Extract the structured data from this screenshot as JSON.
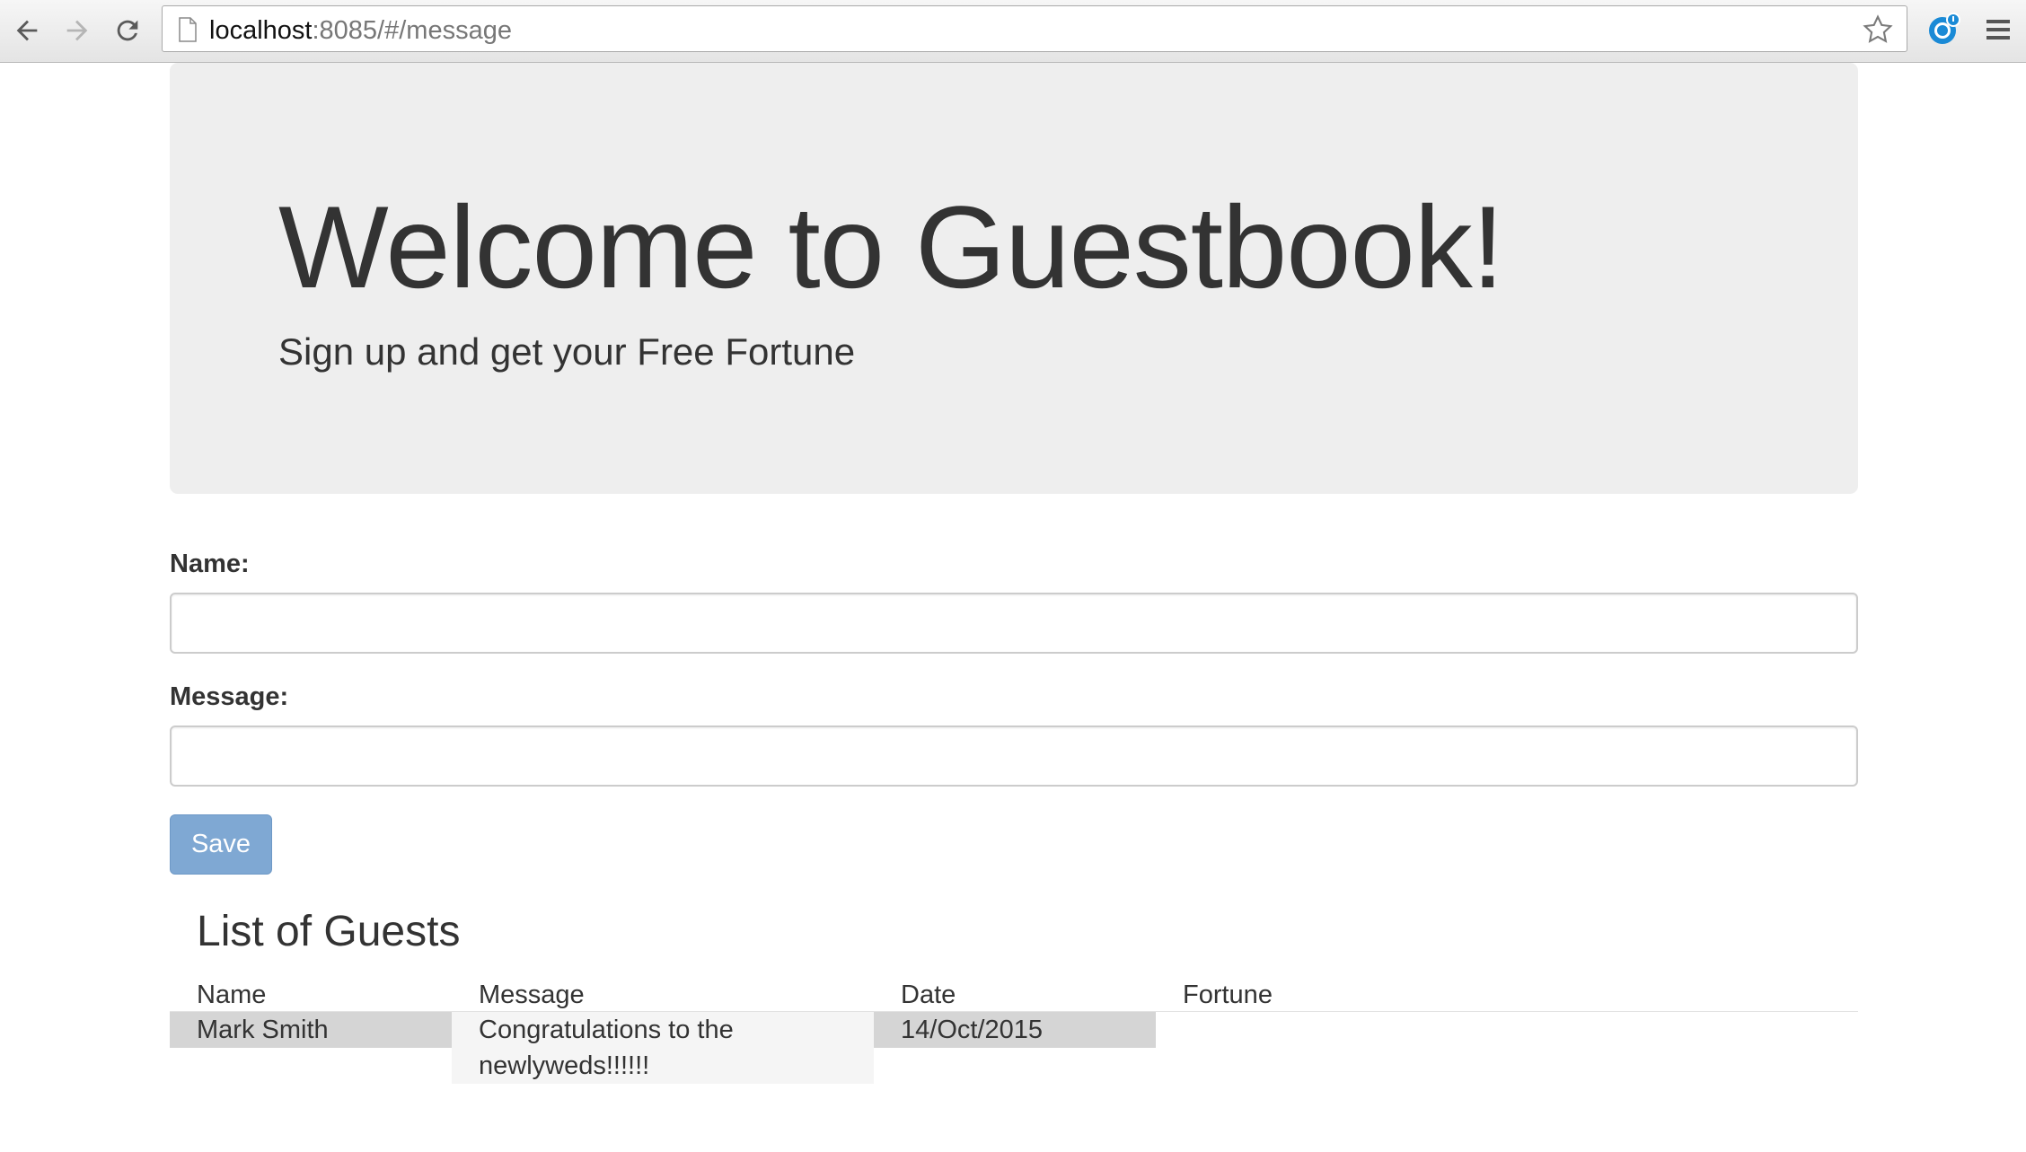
{
  "browser": {
    "url_host": "localhost",
    "url_rest": ":8085/#/message",
    "icons": {
      "back": "back-arrow-icon",
      "forward": "forward-arrow-icon",
      "reload": "reload-icon",
      "page": "page-icon",
      "bookmark": "star-icon",
      "extension": "extension-icon",
      "menu": "hamburger-menu-icon"
    }
  },
  "jumbotron": {
    "title": "Welcome to Guestbook!",
    "subtitle": "Sign up and get your Free Fortune"
  },
  "form": {
    "name_label": "Name:",
    "name_value": "",
    "message_label": "Message:",
    "message_value": "",
    "save_label": "Save"
  },
  "guests": {
    "title": "List of Guests",
    "columns": [
      "Name",
      "Message",
      "Date",
      "Fortune"
    ],
    "rows": [
      {
        "name": "Mark Smith",
        "message_line1": "Congratulations to the",
        "message_line2": "newlyweds!!!!!!",
        "date": "14/Oct/2015",
        "fortune": ""
      }
    ]
  },
  "colors": {
    "jumbotron_bg": "#eeeeee",
    "save_button": "#7fa8d3",
    "text": "#333333"
  }
}
